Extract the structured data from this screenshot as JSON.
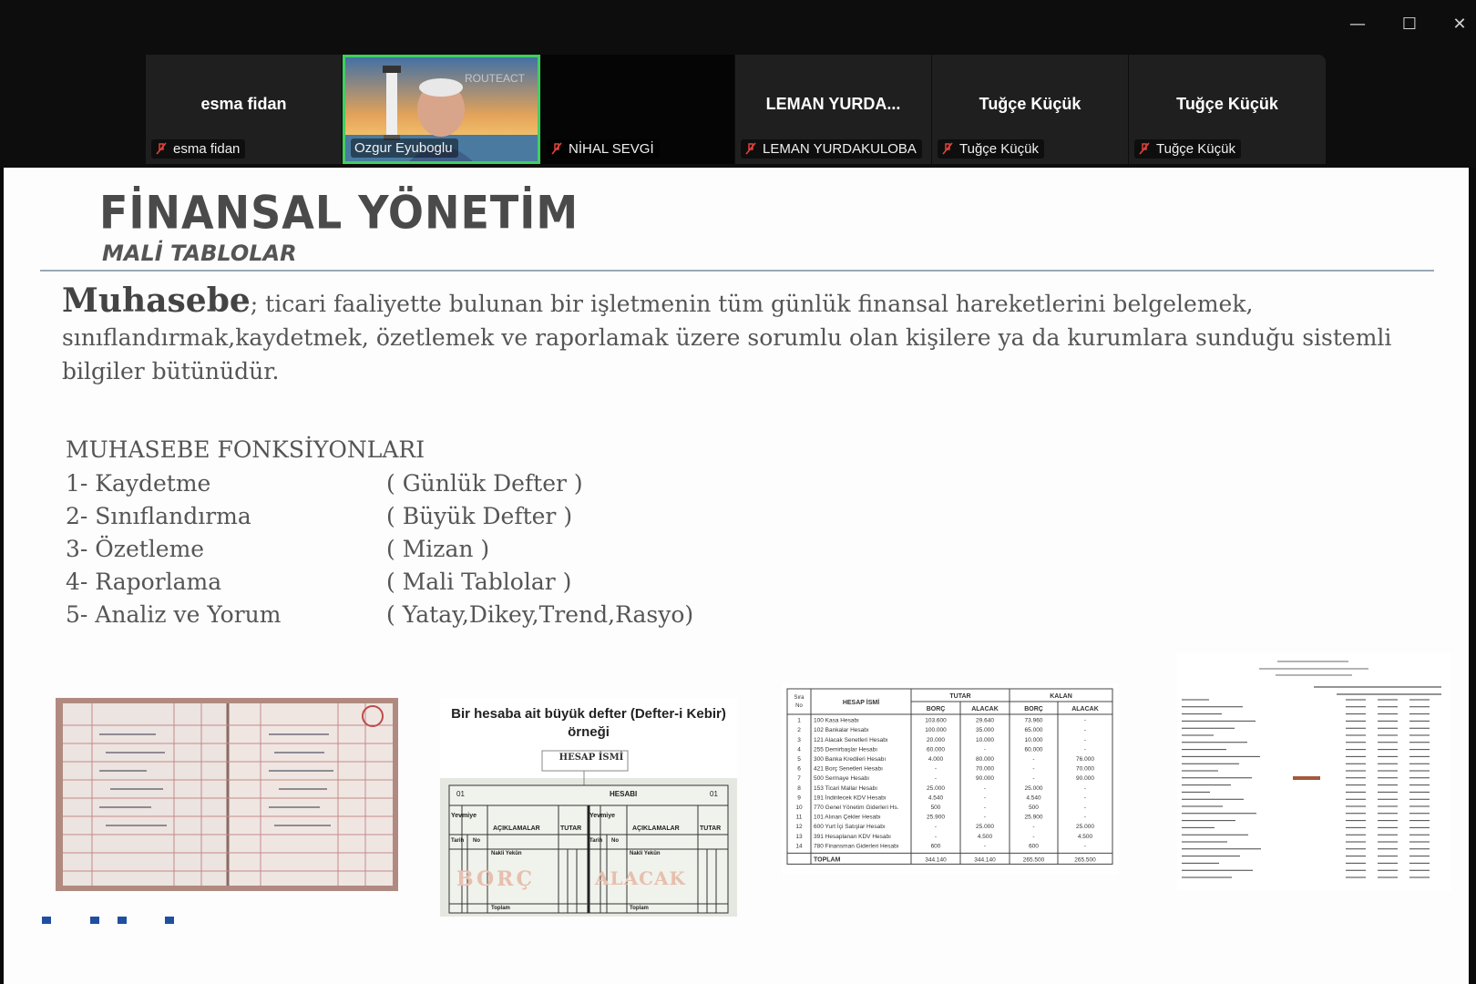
{
  "window": {
    "minimize_glyph": "—",
    "maximize_glyph": "☐",
    "close_glyph": "✕"
  },
  "participants": [
    {
      "display_name": "esma fidan",
      "label": "esma fidan",
      "muted": true
    },
    {
      "display_name": "",
      "label": "Ozgur Eyuboglu",
      "muted": false,
      "video": true,
      "watermark": "ROUTEACT"
    },
    {
      "display_name": "",
      "label": "NİHAL SEVGİ",
      "muted": true
    },
    {
      "display_name": "LEMAN YURDA...",
      "label": "LEMAN YURDAKULOBA",
      "muted": true
    },
    {
      "display_name": "Tuğçe Küçük",
      "label": "Tuğçe Küçük",
      "muted": true
    },
    {
      "display_name": "Tuğçe Küçük",
      "label": "Tuğçe Küçük",
      "muted": true
    }
  ],
  "colors": {
    "active_speaker_border": "#3fcf5f",
    "mute_icon": "#e0443c",
    "slide_background": "#fdfdfd",
    "slide_text": "#555555"
  },
  "slide": {
    "title": "FİNANSAL YÖNETİM",
    "subtitle": "MALİ TABLOLAR",
    "paragraph_lead": "Muhasebe",
    "paragraph_body": "; ticari faaliyette bulunan bir işletmenin tüm günlük finansal hareketlerini belgelemek, sınıflandırmak,kaydetmek, özetlemek ve raporlamak üzere sorumlu olan kişilere ya da kurumlara sunduğu sistemli bilgiler bütünüdür.",
    "functions_heading": "MUHASEBE FONKSİYONLARI",
    "functions": [
      {
        "label": "1- Kaydetme",
        "book": "( Günlük Defter )"
      },
      {
        "label": "2- Sınıflandırma",
        "book": "( Büyük Defter )"
      },
      {
        "label": "3- Özetleme",
        "book": "( Mizan )"
      },
      {
        "label": "4- Raporlama",
        "book": "( Mali Tablolar )"
      },
      {
        "label": "5- Analiz ve Yorum",
        "book": "( Yatay,Dikey,Trend,Rasyo)"
      }
    ],
    "ledger_caption": "Bir hesaba ait büyük defter (Defter-i Kebir) örneği",
    "ledger": {
      "account_name": "HESAP İSMİ",
      "hesabi": "HESABI",
      "num": "01",
      "col_yevmiye": "Yevmiye",
      "col_tarih": "Tarih",
      "col_no": "No",
      "col_aciklamalar": "AÇIKLAMALAR",
      "col_tutar": "TUTAR",
      "nakli_yekun": "Nakli Yekün",
      "toplam": "Toplam",
      "borc": "BORÇ",
      "alacak": "ALACAK"
    },
    "trial_balance": {
      "col_sira": "Sıra No",
      "col_hesap": "HESAP İSMİ",
      "group_tutar": "TUTAR",
      "group_kalan": "KALAN",
      "col_borc": "BORÇ",
      "col_alacak": "ALACAK",
      "rows": [
        [
          "1",
          "100 Kasa Hesabı",
          "103.600",
          "29.640",
          "73.960",
          "-"
        ],
        [
          "2",
          "102 Bankalar Hesabı",
          "100.000",
          "35.000",
          "65.000",
          "-"
        ],
        [
          "3",
          "121 Alacak Senetleri Hesabı",
          "20.000",
          "10.000",
          "10.000",
          "-"
        ],
        [
          "4",
          "255 Demirbaşlar Hesabı",
          "60.000",
          "-",
          "60.000",
          "-"
        ],
        [
          "5",
          "300 Banka Kredileri Hesabı",
          "4.000",
          "80.000",
          "-",
          "76.000"
        ],
        [
          "6",
          "421 Borç Senetleri Hesabı",
          "-",
          "70.000",
          "-",
          "70.000"
        ],
        [
          "7",
          "500 Sermaye Hesabı",
          "-",
          "90.000",
          "-",
          "90.000"
        ],
        [
          "8",
          "153 Ticari Mallar Hesabı",
          "25.000",
          "-",
          "25.000",
          "-"
        ],
        [
          "9",
          "191 İndirilecek KDV Hesabı",
          "4.540",
          "-",
          "4.540",
          "-"
        ],
        [
          "10",
          "770 Genel Yönetim Giderleri Hs.",
          "500",
          "-",
          "500",
          "-"
        ],
        [
          "11",
          "101 Alınan Çekler Hesabı",
          "25.900",
          "-",
          "25.900",
          "-"
        ],
        [
          "12",
          "600 Yurt İçi Satışlar Hesabı",
          "-",
          "25.000",
          "-",
          "25.000"
        ],
        [
          "13",
          "391 Hesaplanan KDV Hesabı",
          "-",
          "4.500",
          "-",
          "4.500"
        ],
        [
          "14",
          "780 Finansman Giderleri Hesabı",
          "600",
          "-",
          "600",
          "-"
        ]
      ],
      "total_label": "TOPLAM",
      "totals": [
        "344.140",
        "344.140",
        "265.500",
        "265.500"
      ]
    }
  }
}
